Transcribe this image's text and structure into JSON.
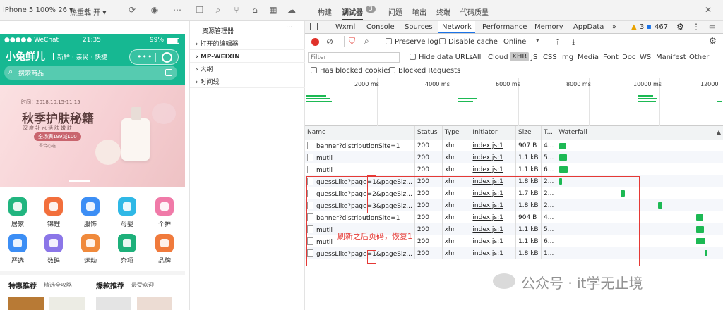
{
  "top_toolbar": {
    "device": "iPhone 5 100% 26 ▾",
    "reload": "热重载 开 ▾",
    "devtools_tabs": [
      "构建",
      "调试器",
      "问题",
      "输出",
      "终端",
      "代码质量"
    ],
    "debugger_badge": "3",
    "active_tab": "调试器"
  },
  "phone": {
    "status_carrier": "●●●●● WeChat",
    "status_time": "21:35",
    "status_battery": "99%",
    "brand": "小兔鲜儿",
    "slogan": "新鲜 · 亲民 · 快捷",
    "search_placeholder": "搜索商品",
    "banner_date": "时间：2018.10.15-11.15",
    "banner_title": "秋季护肤秘籍",
    "banner_sub": "深度补水活肤嫩肤",
    "banner_promo": "全场满199减100",
    "banner_small": "吾合心选",
    "categories": [
      {
        "label": "居家",
        "color": "#21b57f"
      },
      {
        "label": "锦鲤",
        "color": "#f26f3c"
      },
      {
        "label": "服饰",
        "color": "#3c8ef5"
      },
      {
        "label": "母婴",
        "color": "#2fb8e6"
      },
      {
        "label": "个护",
        "color": "#f07aa8"
      },
      {
        "label": "严选",
        "color": "#3c8ef5"
      },
      {
        "label": "数码",
        "color": "#8b76e8"
      },
      {
        "label": "运动",
        "color": "#f08a3c"
      },
      {
        "label": "杂项",
        "color": "#1db07a"
      },
      {
        "label": "品牌",
        "color": "#f07a3c"
      }
    ],
    "section1_title": "特惠推荐",
    "section1_sub": "精选全攻略",
    "section2_title": "爆款推荐",
    "section2_sub": "最受欢迎"
  },
  "explorer": {
    "title": "资源管理器",
    "more": "···",
    "items": [
      "打开的编辑器",
      "MP-WEIXIN",
      "大纲",
      "时间线"
    ]
  },
  "devtools": {
    "tabs": [
      "Wxml",
      "Console",
      "Sources",
      "Network",
      "Performance",
      "Memory",
      "AppData",
      "»"
    ],
    "active_tab": "Network",
    "warn_count": "3",
    "info_count": "467",
    "preserve_log": "Preserve log",
    "disable_cache": "Disable cache",
    "throttle": "Online",
    "filter_placeholder": "Filter",
    "hide_data_urls": "Hide data URLs",
    "type_filters": [
      "All",
      "Cloud",
      "XHR",
      "JS",
      "CSS",
      "Img",
      "Media",
      "Font",
      "Doc",
      "WS",
      "Manifest",
      "Other"
    ],
    "active_type": "XHR",
    "has_blocked_cookies": "Has blocked cookies",
    "blocked_requests": "Blocked Requests",
    "timeline_ticks": [
      "2000 ms",
      "4000 ms",
      "6000 ms",
      "8000 ms",
      "10000 ms",
      "12000"
    ],
    "columns": [
      "Name",
      "Status",
      "Type",
      "Initiator",
      "Size",
      "T...",
      "Waterfall"
    ],
    "requests": [
      {
        "name": "banner?distributionSite=1",
        "status": "200",
        "type": "xhr",
        "initiator": "index.js:1",
        "size": "907 B",
        "time": "4..."
      },
      {
        "name": "mutli",
        "status": "200",
        "type": "xhr",
        "initiator": "index.js:1",
        "size": "1.1 kB",
        "time": "5..."
      },
      {
        "name": "mutli",
        "status": "200",
        "type": "xhr",
        "initiator": "index.js:1",
        "size": "1.1 kB",
        "time": "6..."
      },
      {
        "name": "guessLike?page=1&pageSiz...",
        "status": "200",
        "type": "xhr",
        "initiator": "index.js:1",
        "size": "1.8 kB",
        "time": "2..."
      },
      {
        "name": "guessLike?page=2&pageSiz...",
        "status": "200",
        "type": "xhr",
        "initiator": "index.js:1",
        "size": "1.7 kB",
        "time": "2..."
      },
      {
        "name": "guessLike?page=3&pageSiz...",
        "status": "200",
        "type": "xhr",
        "initiator": "index.js:1",
        "size": "1.8 kB",
        "time": "2..."
      },
      {
        "name": "banner?distributionSite=1",
        "status": "200",
        "type": "xhr",
        "initiator": "index.js:1",
        "size": "904 B",
        "time": "4..."
      },
      {
        "name": "mutli",
        "status": "200",
        "type": "xhr",
        "initiator": "index.js:1",
        "size": "1.1 kB",
        "time": "5..."
      },
      {
        "name": "mutli",
        "status": "200",
        "type": "xhr",
        "initiator": "index.js:1",
        "size": "1.1 kB",
        "time": "6..."
      },
      {
        "name": "guessLike?page=1&pageSiz...",
        "status": "200",
        "type": "xhr",
        "initiator": "index.js:1",
        "size": "1.8 kB",
        "time": "1..."
      }
    ],
    "annotation": "刷新之后页码，恢复1",
    "annotation_color": "#e53935"
  },
  "watermark": "公众号 · it学无止境"
}
